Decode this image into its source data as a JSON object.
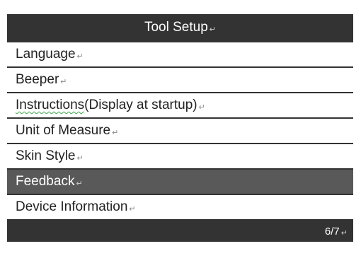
{
  "title": "Tool Setup",
  "return_mark": "↵",
  "menu": {
    "items": [
      {
        "label": "Language"
      },
      {
        "label": "Beeper"
      },
      {
        "label_underlined": "Instructions",
        "label_rest": "(Display at startup)"
      },
      {
        "label": "Unit of Measure"
      },
      {
        "label": "Skin Style"
      },
      {
        "label": "Feedback"
      },
      {
        "label": "Device Information"
      }
    ]
  },
  "status": {
    "page": "6/7"
  },
  "colors": {
    "bar": "#333333",
    "selected": "#595959",
    "text": "#222222"
  },
  "icons": {
    "return_mark": "paragraph-return-icon"
  }
}
